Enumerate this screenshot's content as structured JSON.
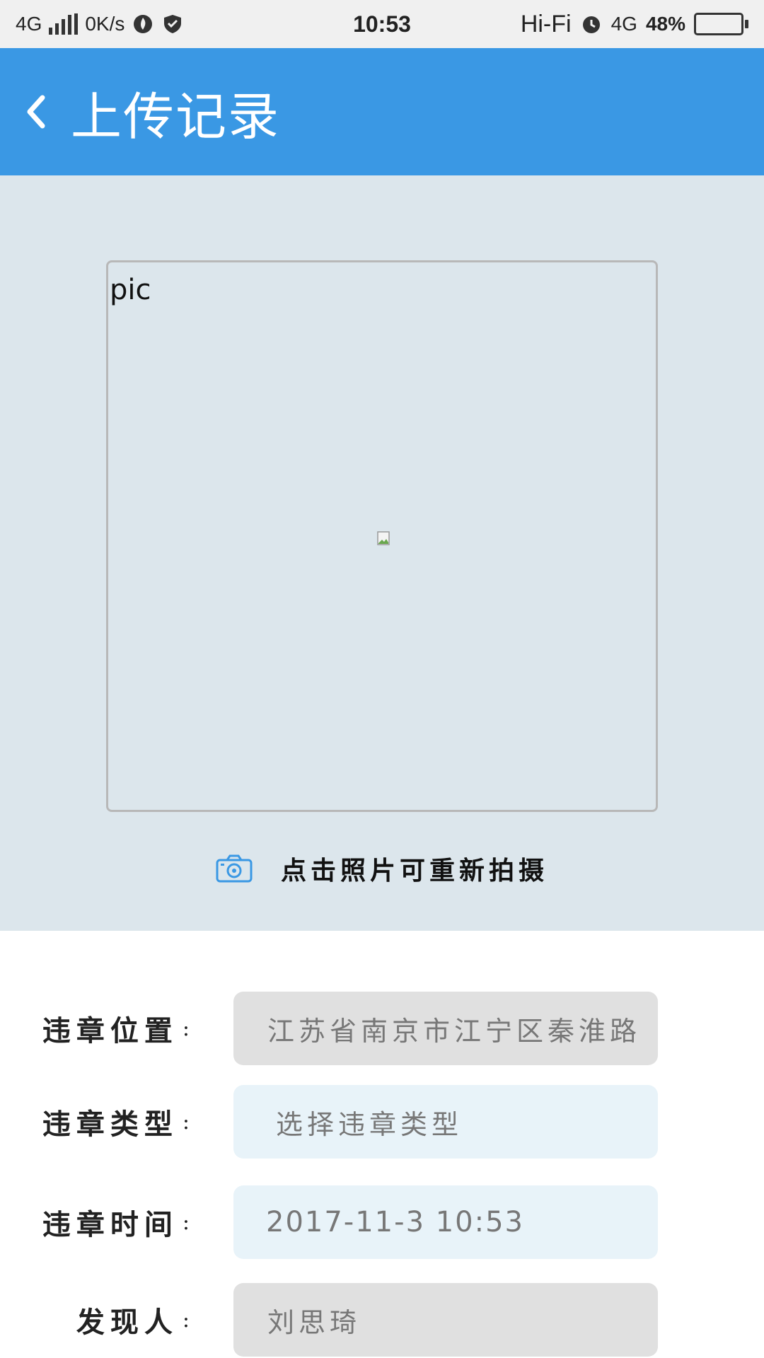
{
  "status_bar": {
    "network": "4G",
    "speed": "0K/s",
    "time": "10:53",
    "hifi": "Hi-Fi",
    "network2": "4G",
    "battery": "48%",
    "battery_level": 0.48
  },
  "header": {
    "title": "上传记录",
    "accent_color": "#3a98e4"
  },
  "photo": {
    "alt_text": "pic",
    "retake_hint": "点击照片可重新拍摄"
  },
  "form": {
    "location": {
      "label": "违章位置",
      "colon": ":",
      "value": "江苏省南京市江宁区秦淮路"
    },
    "type": {
      "label": "违章类型",
      "colon": ":",
      "placeholder": "选择违章类型"
    },
    "time": {
      "label": "违章时间",
      "colon": ":",
      "value": "2017-11-3 10:53"
    },
    "reporter": {
      "label": "发现人",
      "colon": ":",
      "value": "刘思琦"
    }
  }
}
